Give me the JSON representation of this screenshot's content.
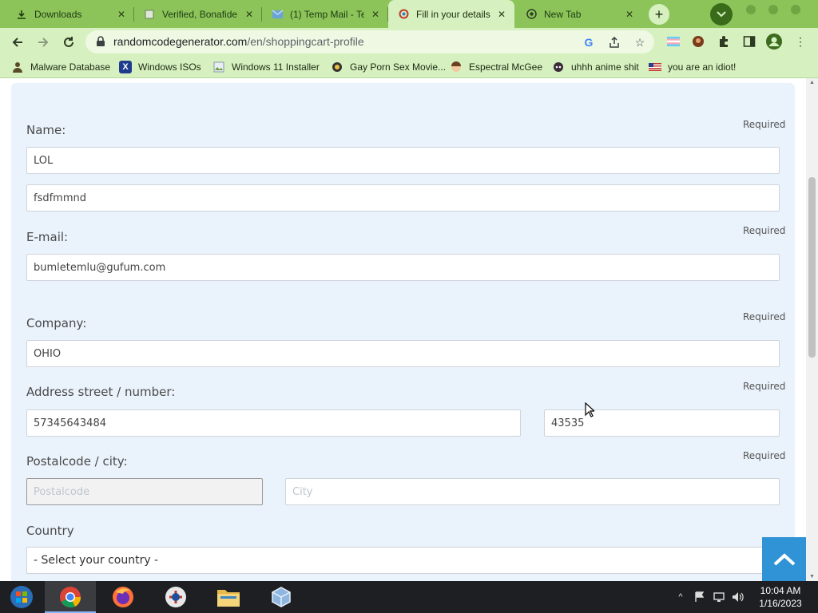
{
  "tabs": [
    {
      "title": "Downloads",
      "icon": "download-icon"
    },
    {
      "title": "Verified, Bonafide",
      "icon": "page-icon"
    },
    {
      "title": "(1) Temp Mail - Te",
      "icon": "mail-icon"
    },
    {
      "title": "Fill in your details",
      "icon": "site-icon"
    },
    {
      "title": "New Tab",
      "icon": "chrome-icon"
    }
  ],
  "address_bar": {
    "domain": "randomcodegenerator.com",
    "path": "/en/shoppingcart-profile"
  },
  "bookmarks": [
    {
      "label": "Malware Database",
      "icon": "user-icon"
    },
    {
      "label": "Windows ISOs",
      "icon": "x-icon"
    },
    {
      "label": "Windows 11 Installer",
      "icon": "image-icon"
    },
    {
      "label": "Gay Porn Sex Movie...",
      "icon": "site-icon"
    },
    {
      "label": "Espectral McGee",
      "icon": "avatar-icon"
    },
    {
      "label": "uhhh anime shit",
      "icon": "anime-icon"
    },
    {
      "label": "you are an idiot!",
      "icon": "flag-icon"
    }
  ],
  "form": {
    "required_text": "Required",
    "name": {
      "label": "Name:",
      "first": "LOL",
      "last": "fsdfmmnd"
    },
    "email": {
      "label": "E-mail:",
      "value": "bumletemlu@gufum.com"
    },
    "company": {
      "label": "Company:",
      "value": "OHIO"
    },
    "address": {
      "label": "Address street / number:",
      "street": "57345643484",
      "number": "43535"
    },
    "postal": {
      "label": "Postalcode / city:",
      "postal_placeholder": "Postalcode",
      "city_placeholder": "City"
    },
    "country": {
      "label": "Country",
      "selected": "- Select your country -"
    }
  },
  "taskbar": {
    "apps": [
      "windows-start",
      "chrome",
      "firefox",
      "obs",
      "file-explorer",
      "virtualbox"
    ],
    "time": "10:04 AM",
    "date": "1/16/2023"
  },
  "colors": {
    "tab_strip": "#8cc45a",
    "toolbar": "#d6f0bf",
    "form_panel": "#eaf2fb",
    "back_to_top": "#2f93d6"
  }
}
